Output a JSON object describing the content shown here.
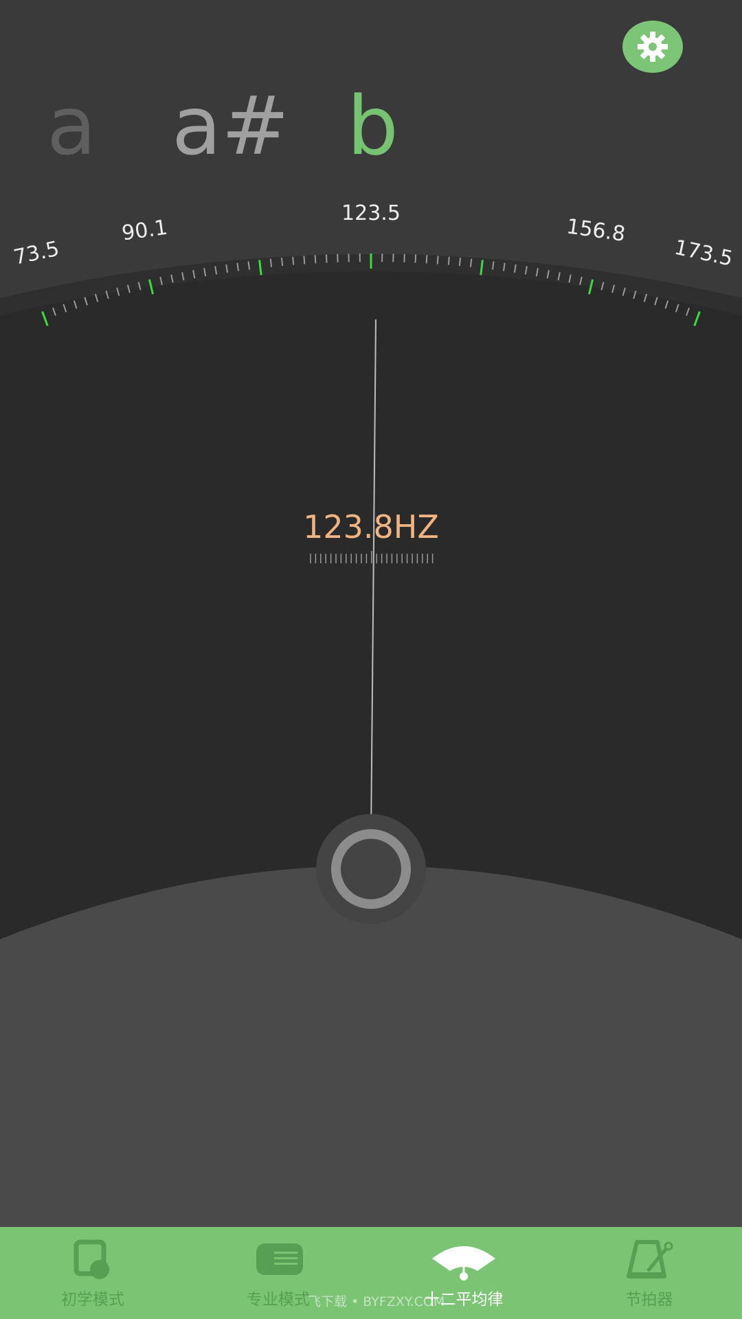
{
  "notes": {
    "prev2": "a",
    "prev1": "a#",
    "current": "b"
  },
  "scale": {
    "labels": [
      "73.5",
      "90.1",
      "123.5",
      "156.8",
      "173.5"
    ]
  },
  "frequency": {
    "readout": "123.8HZ"
  },
  "settings": {
    "icon": "gear-icon"
  },
  "tabs": [
    {
      "label": "初学模式",
      "icon": "beginner-icon",
      "active": false
    },
    {
      "label": "专业模式",
      "icon": "professional-icon",
      "active": false
    },
    {
      "label": "十二平均律",
      "icon": "tuner-gauge-icon",
      "active": true
    },
    {
      "label": "节拍器",
      "icon": "metronome-icon",
      "active": false
    }
  ],
  "watermark": "飞下载 • BYFZXY.COM",
  "colors": {
    "accent": "#7ac474",
    "tick_major": "#3ddc3d",
    "frequency": "#f0b482"
  }
}
